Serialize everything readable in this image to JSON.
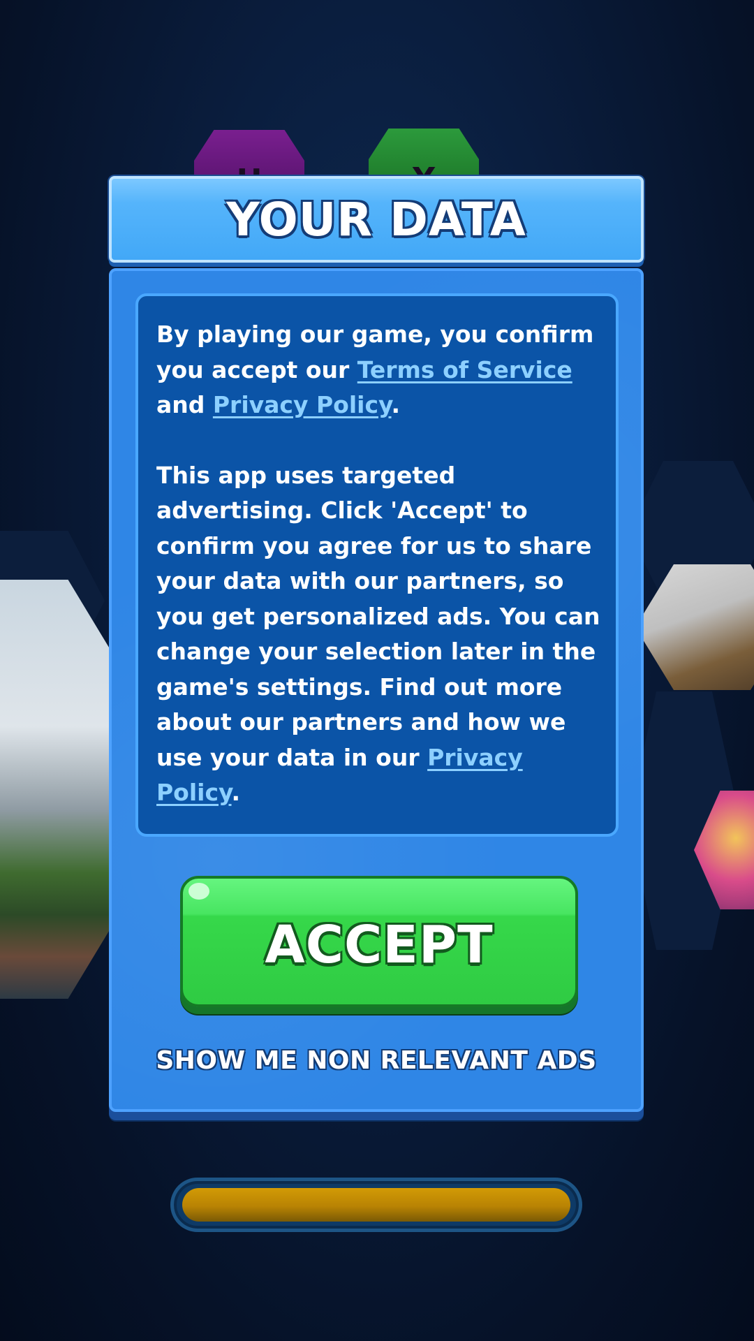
{
  "dialog": {
    "title": "YOUR DATA",
    "paragraph1": {
      "text_a": "By playing our game, you confirm you accept our ",
      "terms_link": "Terms of Service",
      "text_b": " and ",
      "privacy_link": "Privacy Policy",
      "text_c": "."
    },
    "paragraph2": {
      "text_a": "This app uses targeted advertising. Click 'Accept' to confirm you agree for us to share your data with our partners, so you get personalized ads. You can change your selection later in the game's settings. Find out more about our partners and how we use your data in our ",
      "privacy_link": "Privacy Policy",
      "text_b": "."
    },
    "accept_label": "ACCEPT",
    "non_relevant_label": "SHOW ME NON RELEVANT ADS"
  },
  "background_tiles": {
    "left_letter": "H",
    "right_letter": "Y"
  },
  "loading": {
    "progress": 1.0
  },
  "colors": {
    "accent_blue": "#42a8f7",
    "accept_green": "#36d84a",
    "link_blue": "#8dd0ff",
    "loading_gold": "#b88304"
  }
}
